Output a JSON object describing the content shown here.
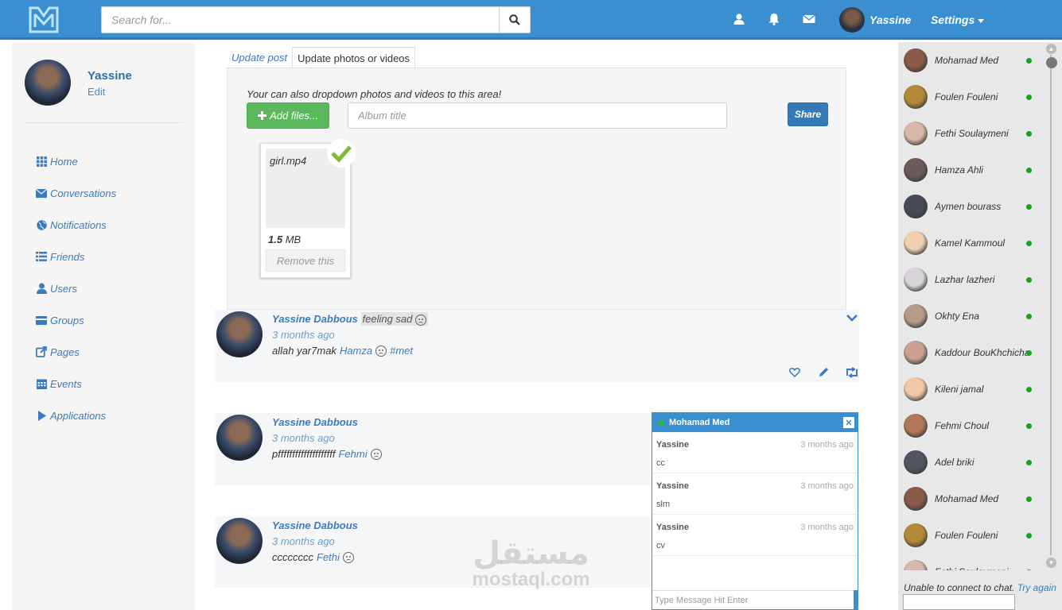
{
  "nav": {
    "search_placeholder": "Search for...",
    "user_name": "Yassine",
    "settings_label": "Settings"
  },
  "profile": {
    "name": "Yassine",
    "edit_label": "Edit"
  },
  "menu": [
    {
      "label": "Home",
      "icon": "grid-icon"
    },
    {
      "label": "Conversations",
      "icon": "envelope-icon"
    },
    {
      "label": "Notifications",
      "icon": "globe-icon"
    },
    {
      "label": "Friends",
      "icon": "list-icon"
    },
    {
      "label": "Users",
      "icon": "user-icon"
    },
    {
      "label": "Groups",
      "icon": "card-icon"
    },
    {
      "label": "Pages",
      "icon": "external-link-icon"
    },
    {
      "label": "Events",
      "icon": "calendar-icon"
    },
    {
      "label": "Applications",
      "icon": "play-icon"
    }
  ],
  "tabs": [
    {
      "label": "Update post",
      "active": false
    },
    {
      "label": "Update photos or videos",
      "active": true
    }
  ],
  "upload": {
    "hint": "Your can also dropdown photos and videos to this area!",
    "add_files_label": "Add files...",
    "album_placeholder": "Album title",
    "share_label": "Share",
    "file": {
      "name": "girl.mp4",
      "size_value": "1.5",
      "size_unit": "MB",
      "remove_label": "Remove this"
    }
  },
  "posts": [
    {
      "author": "Yassine Dabbous",
      "feeling": "feeling sad",
      "time": "3 months ago",
      "text": "allah yar7mak",
      "mention": "Hamza",
      "tag": "#met"
    },
    {
      "author": "Yassine Dabbous",
      "time": "3 months ago",
      "text": "pffffffffffffffffffff",
      "mention": "Fehmi"
    },
    {
      "author": "Yassine Dabbous",
      "time": "3 months ago",
      "text": "cccccccc",
      "mention": "Fethi"
    }
  ],
  "chat": {
    "title": "Mohamad Med",
    "messages": [
      {
        "from": "Yassine",
        "time": "3 months ago",
        "text": "cc"
      },
      {
        "from": "Yassine",
        "time": "3 months ago",
        "text": "slm"
      },
      {
        "from": "Yassine",
        "time": "3 months ago",
        "text": "cv"
      }
    ],
    "input_placeholder": "Type Message Hit Enter"
  },
  "contacts": [
    {
      "name": "Mohamad Med",
      "color": "#8a5a48"
    },
    {
      "name": "Foulen Fouleni",
      "color": "#b58a3a"
    },
    {
      "name": "Fethi Soulaymeni",
      "color": "#d8b8a8"
    },
    {
      "name": "Hamza Ahli",
      "color": "#6a5a58"
    },
    {
      "name": "Aymen bourass",
      "color": "#454a55"
    },
    {
      "name": "Kamel Kammoul",
      "color": "#f0d0b0"
    },
    {
      "name": "Lazhar lazheri",
      "color": "#d8d4da"
    },
    {
      "name": "Okhty Ena",
      "color": "#b89a88"
    },
    {
      "name": "Kaddour BouKhchicha",
      "color": "#caa090"
    },
    {
      "name": "Kileni jamal",
      "color": "#f0c8a8"
    },
    {
      "name": "Fehmi Choul",
      "color": "#b07858"
    },
    {
      "name": "Adel briki",
      "color": "#505560"
    },
    {
      "name": "Mohamad Med",
      "color": "#8a5a48"
    },
    {
      "name": "Foulen Fouleni",
      "color": "#b58a3a"
    },
    {
      "name": "Fethi Soulaymeni",
      "color": "#d8b8a8"
    }
  ],
  "chat_status": {
    "error": "Unable to connect to chat.",
    "retry": "Try again"
  },
  "watermark": {
    "arabic": "مستقل",
    "latin": "mostaql.com"
  }
}
